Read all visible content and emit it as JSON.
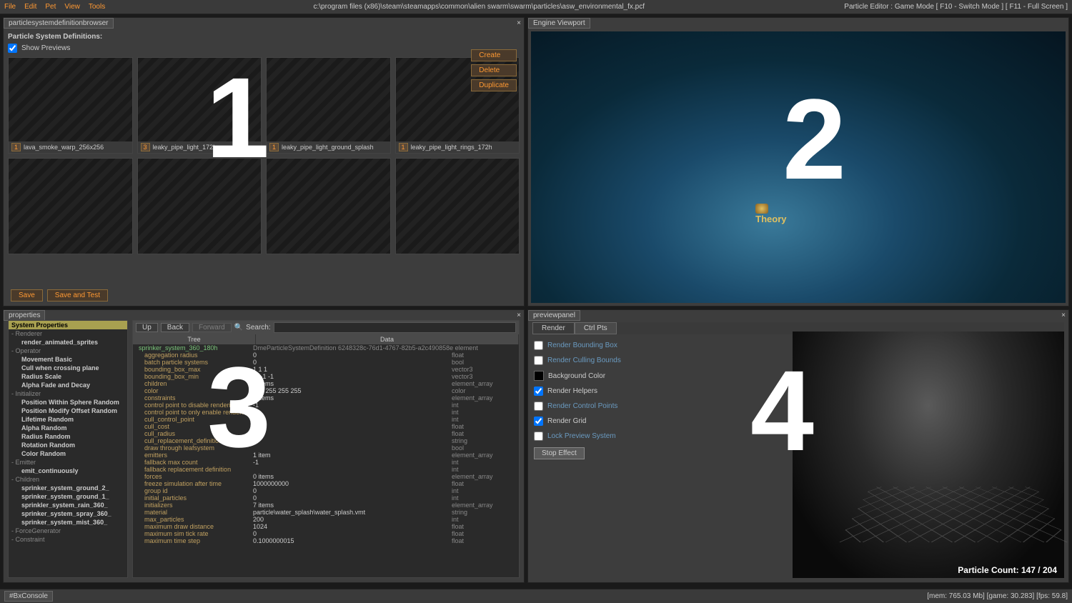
{
  "menubar": {
    "items": [
      "File",
      "Edit",
      "Pet",
      "View",
      "Tools"
    ],
    "title": "c:\\program files (x86)\\steam\\steamapps\\common\\alien swarm\\swarm\\particles\\asw_environmental_fx.pcf",
    "right": "Particle Editor : Game Mode [ F10 - Switch Mode ] [ F11 - Full Screen ]"
  },
  "browser": {
    "tab": "particlesystemdefinitionbrowser",
    "header": "Particle System Definitions:",
    "show_previews": "Show Previews",
    "actions": {
      "create": "Create",
      "delete": "Delete",
      "duplicate": "Duplicate"
    },
    "thumbs": [
      {
        "num": "1",
        "label": "lava_smoke_warp_256x256"
      },
      {
        "num": "3",
        "label": "leaky_pipe_light_172h"
      },
      {
        "num": "1",
        "label": "leaky_pipe_light_ground_splash"
      },
      {
        "num": "1",
        "label": "leaky_pipe_light_rings_172h"
      }
    ],
    "save": "Save",
    "save_test": "Save and Test"
  },
  "viewport": {
    "tab": "Engine Viewport",
    "player": "Theory"
  },
  "properties": {
    "tab": "properties",
    "system_properties": "System Properties",
    "tree_left": [
      {
        "t": "group",
        "v": "Renderer"
      },
      {
        "t": "item",
        "v": "render_animated_sprites",
        "b": true
      },
      {
        "t": "group",
        "v": "Operator"
      },
      {
        "t": "item",
        "v": "Movement Basic",
        "b": true
      },
      {
        "t": "item",
        "v": "Cull when crossing plane",
        "b": true
      },
      {
        "t": "item",
        "v": "Radius Scale",
        "b": true
      },
      {
        "t": "item",
        "v": "Alpha Fade and Decay",
        "b": true
      },
      {
        "t": "group",
        "v": "Initializer"
      },
      {
        "t": "item",
        "v": "Position Within Sphere Random",
        "b": true
      },
      {
        "t": "item",
        "v": "Position Modify Offset Random",
        "b": true
      },
      {
        "t": "item",
        "v": "Lifetime Random",
        "b": true
      },
      {
        "t": "item",
        "v": "Alpha Random",
        "b": true
      },
      {
        "t": "item",
        "v": "Radius Random",
        "b": true
      },
      {
        "t": "item",
        "v": "Rotation Random",
        "b": true
      },
      {
        "t": "item",
        "v": "Color Random",
        "b": true
      },
      {
        "t": "group",
        "v": "Emitter"
      },
      {
        "t": "item",
        "v": "emit_continuously",
        "b": true
      },
      {
        "t": "group",
        "v": "Children"
      },
      {
        "t": "item",
        "v": "sprinker_system_ground_2_",
        "b": true
      },
      {
        "t": "item",
        "v": "sprinker_system_ground_1_",
        "b": true
      },
      {
        "t": "item",
        "v": "sprinkler_system_rain_360_",
        "b": true
      },
      {
        "t": "item",
        "v": "sprinker_system_spray_360_",
        "b": true
      },
      {
        "t": "item",
        "v": "sprinker_system_mist_360_",
        "b": true
      },
      {
        "t": "group",
        "v": "ForceGenerator"
      },
      {
        "t": "group",
        "v": "Constraint"
      }
    ],
    "toolbar": {
      "up": "Up",
      "back": "Back",
      "fwd": "Forward",
      "search": "Search:"
    },
    "headers": {
      "tree": "Tree",
      "data": "Data"
    },
    "root": {
      "name": "sprinker_system_360_180h",
      "meta": "DmeParticleSystemDefinition 6248328c-76d1-4767-82b5-a2c490858e  element"
    },
    "rows": [
      {
        "k": "aggregation radius",
        "v": "0",
        "t": "float"
      },
      {
        "k": "batch particle systems",
        "v": "0",
        "t": "bool"
      },
      {
        "k": "bounding_box_max",
        "v": "1 1 1",
        "t": "vector3"
      },
      {
        "k": "bounding_box_min",
        "v": "-1 -1 -1",
        "t": "vector3"
      },
      {
        "k": "children",
        "v": "5 items",
        "t": "element_array"
      },
      {
        "k": "color",
        "v": "255 255 255 255",
        "t": "color"
      },
      {
        "k": "constraints",
        "v": "0 items",
        "t": "element_array"
      },
      {
        "k": "control point to disable rendering",
        "v": "-1",
        "t": "int"
      },
      {
        "k": "control point to only enable rendering",
        "v": "",
        "t": "int"
      },
      {
        "k": "cull_control_point",
        "v": "0",
        "t": "int"
      },
      {
        "k": "cull_cost",
        "v": "",
        "t": "float"
      },
      {
        "k": "cull_radius",
        "v": "",
        "t": "float"
      },
      {
        "k": "cull_replacement_definition",
        "v": "",
        "t": "string"
      },
      {
        "k": "draw through leafsystem",
        "v": "",
        "t": "bool"
      },
      {
        "k": "emitters",
        "v": "1 item",
        "t": "element_array"
      },
      {
        "k": "fallback max count",
        "v": "-1",
        "t": "int"
      },
      {
        "k": "fallback replacement definition",
        "v": "",
        "t": "int"
      },
      {
        "k": "forces",
        "v": "0 items",
        "t": "element_array"
      },
      {
        "k": "freeze simulation after time",
        "v": "1000000000",
        "t": "float"
      },
      {
        "k": "group id",
        "v": "0",
        "t": "int"
      },
      {
        "k": "initial_particles",
        "v": "0",
        "t": "int"
      },
      {
        "k": "initializers",
        "v": "7 items",
        "t": "element_array"
      },
      {
        "k": "material",
        "v": "particle\\water_splash\\water_splash.vmt",
        "t": "string"
      },
      {
        "k": "max_particles",
        "v": "200",
        "t": "int"
      },
      {
        "k": "maximum draw distance",
        "v": "1024",
        "t": "float"
      },
      {
        "k": "maximum sim tick rate",
        "v": "0",
        "t": "float"
      },
      {
        "k": "maximum time step",
        "v": "0.1000000015",
        "t": "float"
      }
    ]
  },
  "preview": {
    "tab": "previewpanel",
    "tabs": {
      "render": "Render",
      "ctrl": "Ctrl Pts"
    },
    "opts": [
      {
        "label": "Render Bounding Box",
        "checked": false,
        "link": true
      },
      {
        "label": "Render Culling Bounds",
        "checked": false,
        "link": true
      },
      {
        "label": "Background Color",
        "checked": false,
        "link": false,
        "color": true
      },
      {
        "label": "Render Helpers",
        "checked": true,
        "link": false
      },
      {
        "label": "Render Control Points",
        "checked": false,
        "link": true
      },
      {
        "label": "Render Grid",
        "checked": true,
        "link": false
      },
      {
        "label": "Lock Preview System",
        "checked": false,
        "link": true
      }
    ],
    "stop": "Stop Effect",
    "count": "Particle Count:  147 /  204"
  },
  "status": {
    "console": "#BxConsole",
    "stats": "[mem: 765.03 Mb] [game: 30.283]    [fps: 59.8]"
  }
}
